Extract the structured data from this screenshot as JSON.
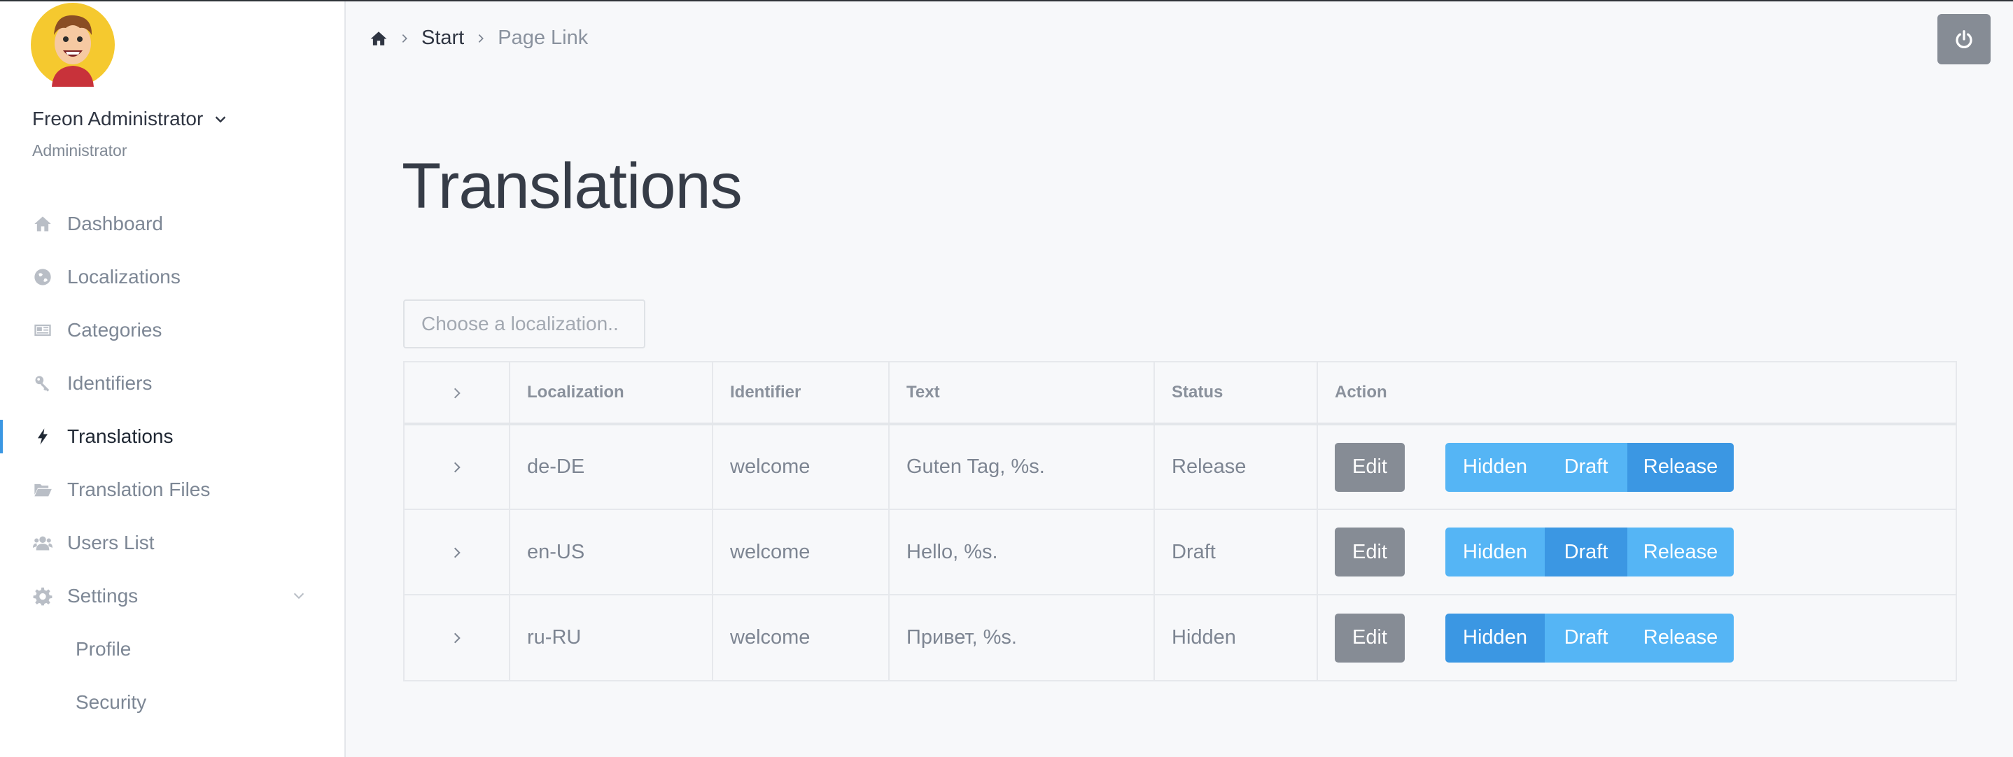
{
  "user": {
    "name": "Freon Administrator",
    "role": "Administrator"
  },
  "sidebar": {
    "items": [
      {
        "label": "Dashboard",
        "icon": "home-icon"
      },
      {
        "label": "Localizations",
        "icon": "globe-icon"
      },
      {
        "label": "Categories",
        "icon": "newspaper-icon"
      },
      {
        "label": "Identifiers",
        "icon": "key-icon"
      },
      {
        "label": "Translations",
        "icon": "bolt-icon",
        "active": true
      },
      {
        "label": "Translation Files",
        "icon": "folder-open-icon"
      },
      {
        "label": "Users List",
        "icon": "users-icon"
      },
      {
        "label": "Settings",
        "icon": "gear-icon"
      }
    ],
    "settings_sub": [
      {
        "label": "Profile"
      },
      {
        "label": "Security"
      }
    ]
  },
  "breadcrumb": {
    "start": "Start",
    "current": "Page Link"
  },
  "page": {
    "title": "Translations",
    "localization_placeholder": "Choose a localization.."
  },
  "table": {
    "columns": [
      "Localization",
      "Identifier",
      "Text",
      "Status",
      "Action"
    ],
    "rows": [
      {
        "localization": "de-DE",
        "identifier": "welcome",
        "text": "Guten Tag, %s.",
        "status": "Release"
      },
      {
        "localization": "en-US",
        "identifier": "welcome",
        "text": "Hello, %s.",
        "status": "Draft"
      },
      {
        "localization": "ru-RU",
        "identifier": "welcome",
        "text": "Привет, %s.",
        "status": "Hidden"
      }
    ],
    "edit_label": "Edit",
    "status_buttons": {
      "hidden": "Hidden",
      "draft": "Draft",
      "release": "Release"
    }
  },
  "colors": {
    "accent": "#3b97e3",
    "segment_idle": "#55b5f5",
    "edit_button": "#868c95"
  }
}
